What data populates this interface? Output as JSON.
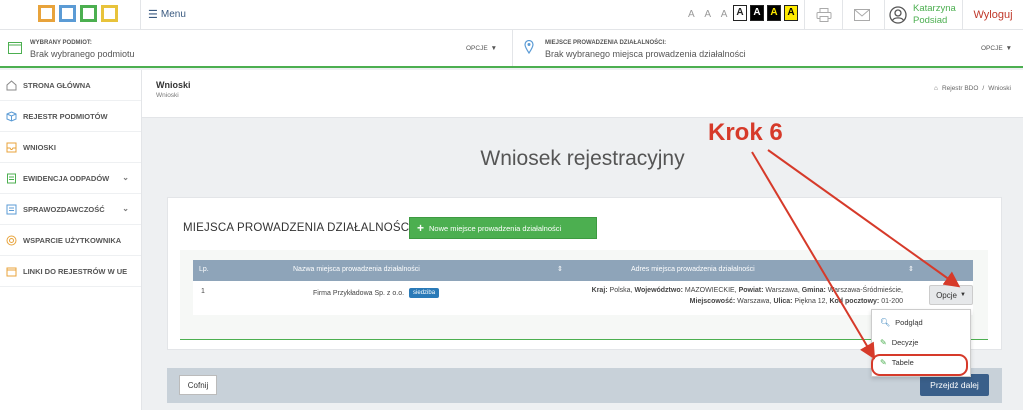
{
  "header": {
    "menu_label": "Menu",
    "font_sizes": "A A A",
    "contrast": [
      "A",
      "A",
      "A",
      "A"
    ],
    "user_first": "Katarzyna",
    "user_last": "Podsiad",
    "logout_label": "Wyloguj"
  },
  "subject_bar": {
    "subject_label": "WYBRANY PODMIOT:",
    "subject_value": "Brak wybranego podmiotu",
    "options_label_1": "OPCJE",
    "place_label": "MIEJSCE PROWADZENIA DZIAŁALNOŚCI:",
    "place_value": "Brak wybranego miejsca prowadzenia działalności",
    "options_label_2": "OPCJE"
  },
  "sidebar": {
    "items": [
      {
        "label": "STRONA GŁÓWNA"
      },
      {
        "label": "REJESTR PODMIOTÓW"
      },
      {
        "label": "WNIOSKI"
      },
      {
        "label": "EWIDENCJA ODPADÓW"
      },
      {
        "label": "SPRAWOZDAWCZOŚĆ"
      },
      {
        "label": "WSPARCIE UŻYTKOWNIKA"
      },
      {
        "label": "LINKI DO REJESTRÓW W UE"
      }
    ]
  },
  "page": {
    "title": "Wnioski",
    "subtitle": "Wnioski",
    "breadcrumb": [
      "Rejestr BDO",
      "/",
      "Wnioski"
    ],
    "main_title": "Wniosek rejestracyjny"
  },
  "panel": {
    "title": "MIEJSCA PROWADZENIA DZIAŁALNOŚCI",
    "add_button": "Nowe miejsce prowadzenia działalności",
    "columns": [
      "Lp.",
      "Nazwa miejsca prowadzenia działalności",
      "Adres miejsca prowadzenia działalności"
    ],
    "rows": [
      {
        "lp": "1",
        "name": "Firma Przykładowa Sp. z o.o.",
        "badge": "siedziba",
        "addr": {
          "k_kraj": "Kraj:",
          "v_kraj": " Polska, ",
          "k_woj": "Województwo:",
          "v_woj": " MAZOWIECKIE, ",
          "k_pow": "Powiat:",
          "v_pow": " Warszawa, ",
          "k_gmina": "Gmina:",
          "v_gmina": " Warszawa-Śródmieście, ",
          "k_miej": "Miejscowość:",
          "v_miej": " Warszawa, ",
          "k_ulica": "Ulica:",
          "v_ulica": " Piękna 12, ",
          "k_kod": "Kod pocztowy:",
          "v_kod": " 01-200"
        },
        "options_button": "Opcje"
      }
    ]
  },
  "dropdown": {
    "items": [
      "Podgląd",
      "Decyzje",
      "Tabele"
    ]
  },
  "footer": {
    "back_button": "Cofnij",
    "next_button": "Przejdź dalej"
  },
  "annotation": {
    "label": "Krok 6"
  },
  "colors": {
    "brand_green": "#4caf50",
    "primary_blue": "#3a5f8a",
    "annotation_red": "#d63a2a",
    "logout_red": "#c0392b"
  }
}
